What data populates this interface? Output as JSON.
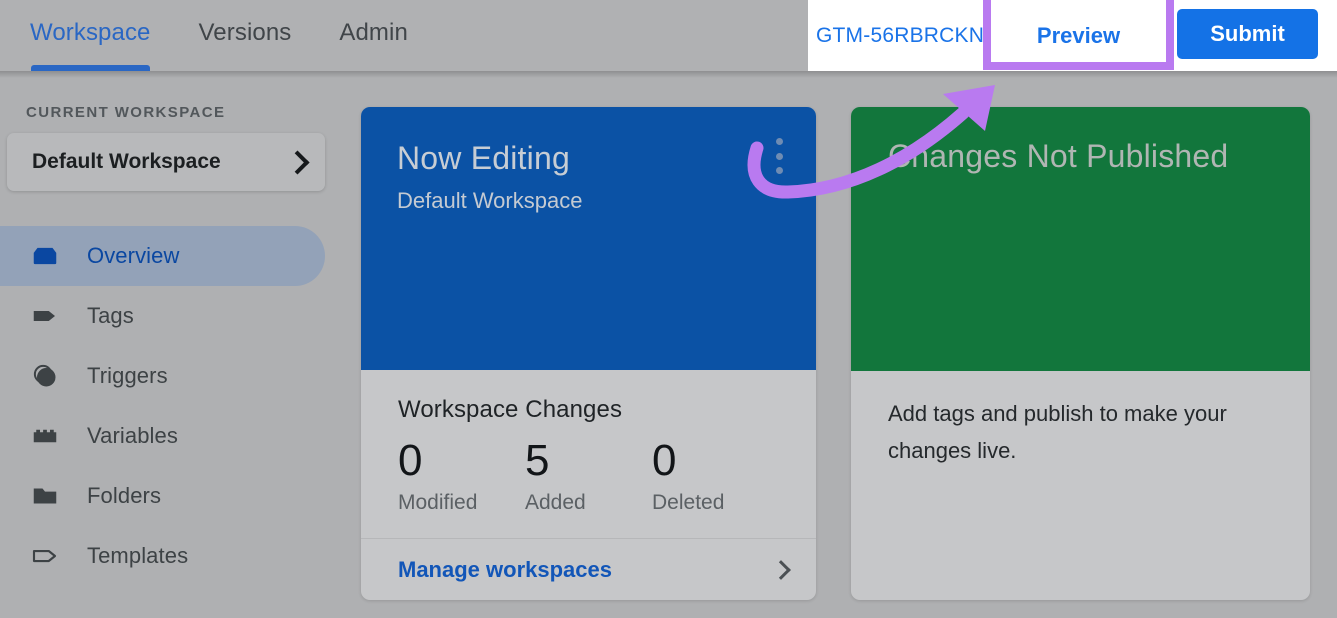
{
  "topbar": {
    "tabs": [
      {
        "label": "Workspace",
        "active": true
      },
      {
        "label": "Versions",
        "active": false
      },
      {
        "label": "Admin",
        "active": false
      }
    ],
    "container_id": "GTM-56RBRCKN",
    "preview_label": "Preview",
    "submit_label": "Submit",
    "highlight_color": "#b97af0",
    "link_color": "#1a73e8",
    "submit_bg": "#1472e6"
  },
  "sidebar": {
    "section_label": "CURRENT WORKSPACE",
    "workspace_name": "Default Workspace",
    "chevron_icon": "chevron-right-icon",
    "items": [
      {
        "label": "Overview",
        "icon": "overview-box-icon",
        "selected": true
      },
      {
        "label": "Tags",
        "icon": "tag-filled-icon",
        "selected": false
      },
      {
        "label": "Triggers",
        "icon": "trigger-circle-icon",
        "selected": false
      },
      {
        "label": "Variables",
        "icon": "variables-brick-icon",
        "selected": false
      },
      {
        "label": "Folders",
        "icon": "folder-icon",
        "selected": false
      },
      {
        "label": "Templates",
        "icon": "template-tag-outline-icon",
        "selected": false
      }
    ],
    "selected_bg": "#93a2b8",
    "selected_text": "#0a47a1"
  },
  "cards": {
    "editing": {
      "title": "Now Editing",
      "subtitle": "Default Workspace",
      "header_bg": "#0b52a5",
      "menu_icon": "more-vert-icon",
      "changes_title": "Workspace Changes",
      "stats": [
        {
          "value": "0",
          "label": "Modified"
        },
        {
          "value": "5",
          "label": "Added"
        },
        {
          "value": "0",
          "label": "Deleted"
        }
      ],
      "manage_link": "Manage workspaces"
    },
    "published": {
      "title": "Changes Not Published",
      "header_bg": "#12763c",
      "body": "Add tags and publish to make your changes live."
    }
  },
  "annotation": {
    "arrow_color": "#b97af0",
    "description": "curved arrow pointing from card menu to Preview button"
  }
}
